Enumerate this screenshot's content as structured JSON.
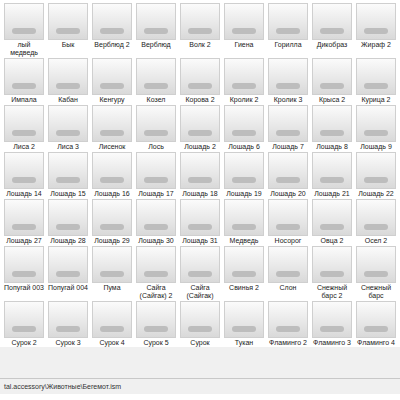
{
  "grid": {
    "rows": [
      [
        "лый медведь",
        "Бык",
        "Верблюд 2",
        "Верблюд",
        "Волк 2",
        "Гиена",
        "Горилла",
        "Дикобраз",
        "Жираф 2"
      ],
      [
        "Импала",
        "Кабан",
        "Кенгуру",
        "Козел",
        "Корова 2",
        "Кролик 2",
        "Кролик 3",
        "Крыса 2",
        "Курица 2"
      ],
      [
        "Лиса 2",
        "Лиса 3",
        "Лисенок",
        "Лось",
        "Лошадь 2",
        "Лошадь 6",
        "Лошадь 7",
        "Лошадь 8",
        "Лошадь 9"
      ],
      [
        "Лошадь 14",
        "Лошадь 15",
        "Лошадь 16",
        "Лошадь 17",
        "Лошадь 18",
        "Лошадь 19",
        "Лошадь 20",
        "Лошадь 21",
        "Лошадь 22"
      ],
      [
        "Лошадь 27",
        "Лошадь 28",
        "Лошадь 29",
        "Лошадь 30",
        "Лошадь 31",
        "Медведь",
        "Носорог",
        "Овца 2",
        "Осел 2"
      ],
      [
        "Попугай 003",
        "Попугай 004",
        "Пума",
        "Сайга (Сайгак) 2",
        "Сайга (Сайгак)",
        "Свинья 2",
        "Слон",
        "Снежный барс 2",
        "Снежный барс"
      ],
      [
        "Сурок 2",
        "Сурок 3",
        "Сурок 4",
        "Сурок 5",
        "Сурок",
        "Тукан",
        "Фламинго 2",
        "Фламинго 3",
        "Фламинго 4"
      ]
    ]
  },
  "status_bar": {
    "path": "tal.accessory\\Животные\\Бегемот.ism"
  }
}
